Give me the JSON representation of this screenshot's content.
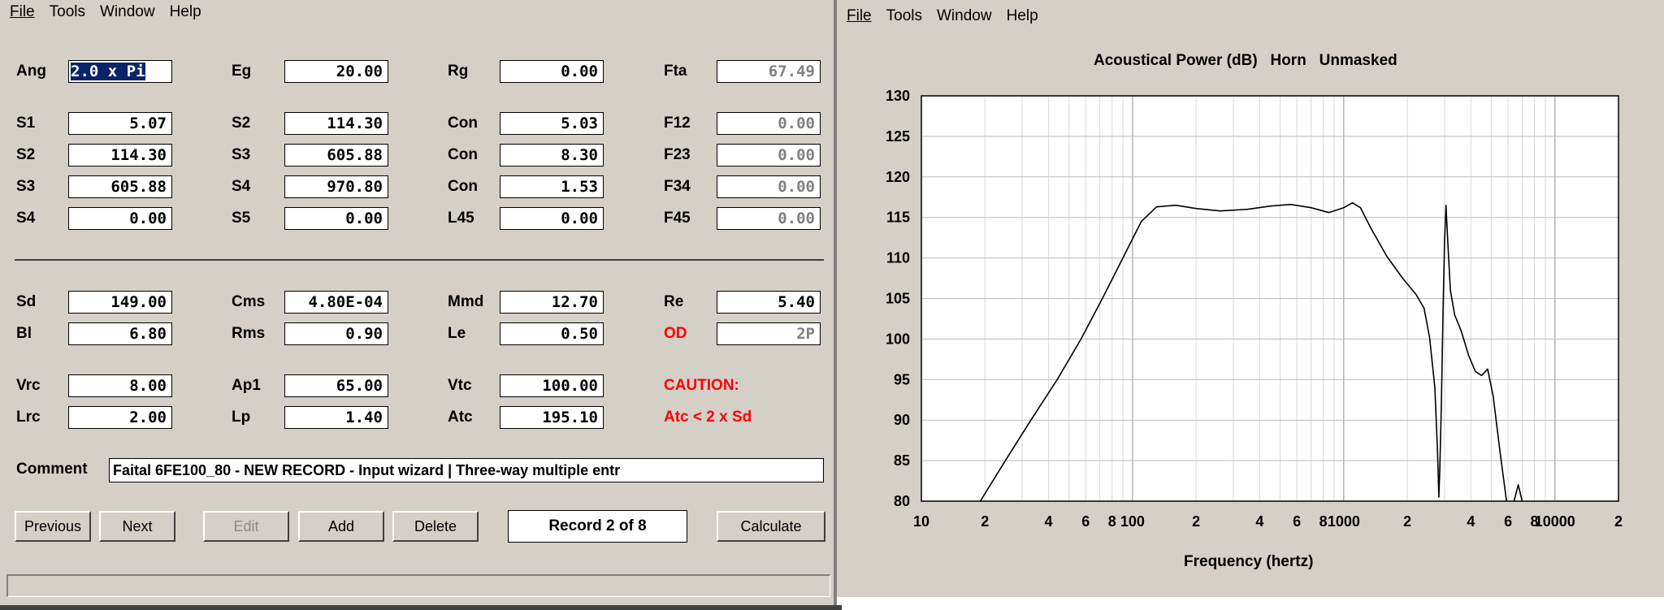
{
  "left_window": {
    "menu": [
      "File",
      "Tools",
      "Window",
      "Help"
    ],
    "rows": [
      {
        "cells": [
          {
            "label": "Ang",
            "value": "2.0 x Pi",
            "selected": true
          },
          {
            "label": "Eg",
            "value": "20.00"
          },
          {
            "label": "Rg",
            "value": "0.00"
          },
          {
            "label": "Fta",
            "value": "67.49",
            "readonly": true
          }
        ]
      },
      {
        "cells": [
          {
            "label": "S1",
            "value": "5.07"
          },
          {
            "label": "S2",
            "value": "114.30"
          },
          {
            "label": "Con",
            "value": "5.03"
          },
          {
            "label": "F12",
            "value": "0.00",
            "readonly": true
          }
        ]
      },
      {
        "cells": [
          {
            "label": "S2",
            "value": "114.30"
          },
          {
            "label": "S3",
            "value": "605.88"
          },
          {
            "label": "Con",
            "value": "8.30"
          },
          {
            "label": "F23",
            "value": "0.00",
            "readonly": true
          }
        ]
      },
      {
        "cells": [
          {
            "label": "S3",
            "value": "605.88"
          },
          {
            "label": "S4",
            "value": "970.80"
          },
          {
            "label": "Con",
            "value": "1.53"
          },
          {
            "label": "F34",
            "value": "0.00",
            "readonly": true
          }
        ]
      },
      {
        "cells": [
          {
            "label": "S4",
            "value": "0.00"
          },
          {
            "label": "S5",
            "value": "0.00"
          },
          {
            "label": "L45",
            "value": "0.00"
          },
          {
            "label": "F45",
            "value": "0.00",
            "readonly": true
          }
        ]
      },
      {
        "cells": [
          {
            "label": "Sd",
            "value": "149.00"
          },
          {
            "label": "Cms",
            "value": "4.80E-04"
          },
          {
            "label": "Mmd",
            "value": "12.70"
          },
          {
            "label": "Re",
            "value": "5.40"
          }
        ]
      },
      {
        "cells": [
          {
            "label": "Bl",
            "value": "6.80"
          },
          {
            "label": "Rms",
            "value": "0.90"
          },
          {
            "label": "Le",
            "value": "0.50"
          },
          {
            "label": "OD",
            "value": "2P",
            "readonly": true,
            "red_label": true
          }
        ]
      },
      {
        "cells": [
          {
            "label": "Vrc",
            "value": "8.00"
          },
          {
            "label": "Ap1",
            "value": "65.00"
          },
          {
            "label": "Vtc",
            "value": "100.00"
          }
        ]
      },
      {
        "cells": [
          {
            "label": "Lrc",
            "value": "2.00"
          },
          {
            "label": "Lp",
            "value": "1.40"
          },
          {
            "label": "Atc",
            "value": "195.10"
          }
        ]
      }
    ],
    "caution_title": "CAUTION:",
    "caution_text": "Atc < 2 x Sd",
    "comment_label": "Comment",
    "comment_value": "Faital 6FE100_80 - NEW RECORD - Input wizard | Three-way multiple entr",
    "buttons": {
      "previous": "Previous",
      "next": "Next",
      "edit": "Edit",
      "add": "Add",
      "delete": "Delete",
      "calculate": "Calculate"
    },
    "record_text": "Record 2 of 8"
  },
  "right_window": {
    "menu": [
      "File",
      "Tools",
      "Window",
      "Help"
    ]
  },
  "chart_data": {
    "type": "line",
    "title": "Acoustical Power (dB)   Horn   Unmasked",
    "xlabel": "Frequency (hertz)",
    "ylabel": "",
    "x_scale": "log",
    "xlim": [
      10,
      20000
    ],
    "ylim": [
      80,
      130
    ],
    "yticks": [
      80,
      85,
      90,
      95,
      100,
      105,
      110,
      115,
      120,
      125,
      130
    ],
    "xtick_labels": [
      {
        "v": 10,
        "t": "10"
      },
      {
        "v": 20,
        "t": "2"
      },
      {
        "v": 40,
        "t": "4"
      },
      {
        "v": 60,
        "t": "6"
      },
      {
        "v": 80,
        "t": "8"
      },
      {
        "v": 100,
        "t": "100"
      },
      {
        "v": 200,
        "t": "2"
      },
      {
        "v": 400,
        "t": "4"
      },
      {
        "v": 600,
        "t": "6"
      },
      {
        "v": 800,
        "t": "8"
      },
      {
        "v": 1000,
        "t": "1000"
      },
      {
        "v": 2000,
        "t": "2"
      },
      {
        "v": 4000,
        "t": "4"
      },
      {
        "v": 6000,
        "t": "6"
      },
      {
        "v": 8000,
        "t": "8"
      },
      {
        "v": 10000,
        "t": "10000"
      },
      {
        "v": 20000,
        "t": "2"
      }
    ],
    "grid": true,
    "series": [
      {
        "points": [
          [
            19,
            80
          ],
          [
            25,
            85
          ],
          [
            33,
            90
          ],
          [
            44,
            95
          ],
          [
            57,
            100
          ],
          [
            72,
            105
          ],
          [
            90,
            110
          ],
          [
            110,
            114.5
          ],
          [
            130,
            116.3
          ],
          [
            160,
            116.5
          ],
          [
            200,
            116.1
          ],
          [
            260,
            115.8
          ],
          [
            350,
            116.0
          ],
          [
            450,
            116.4
          ],
          [
            560,
            116.6
          ],
          [
            700,
            116.2
          ],
          [
            850,
            115.6
          ],
          [
            1000,
            116.2
          ],
          [
            1100,
            116.8
          ],
          [
            1200,
            116.2
          ],
          [
            1350,
            113.6
          ],
          [
            1600,
            110.2
          ],
          [
            1900,
            107.5
          ],
          [
            2200,
            105.5
          ],
          [
            2400,
            103.8
          ],
          [
            2550,
            100.2
          ],
          [
            2700,
            94.0
          ],
          [
            2780,
            86.0
          ],
          [
            2820,
            80.5
          ],
          [
            2850,
            84.0
          ],
          [
            2900,
            92.0
          ],
          [
            2950,
            103.0
          ],
          [
            3000,
            112.0
          ],
          [
            3050,
            116.5
          ],
          [
            3100,
            112.5
          ],
          [
            3200,
            106.0
          ],
          [
            3350,
            103.0
          ],
          [
            3600,
            101.0
          ],
          [
            3900,
            98.0
          ],
          [
            4200,
            96.0
          ],
          [
            4500,
            95.5
          ],
          [
            4800,
            96.3
          ],
          [
            5100,
            93.0
          ],
          [
            5500,
            86.0
          ],
          [
            5900,
            80.0
          ]
        ]
      },
      {
        "points": [
          [
            6400,
            80
          ],
          [
            6700,
            82.0
          ],
          [
            7000,
            80
          ]
        ]
      }
    ]
  }
}
